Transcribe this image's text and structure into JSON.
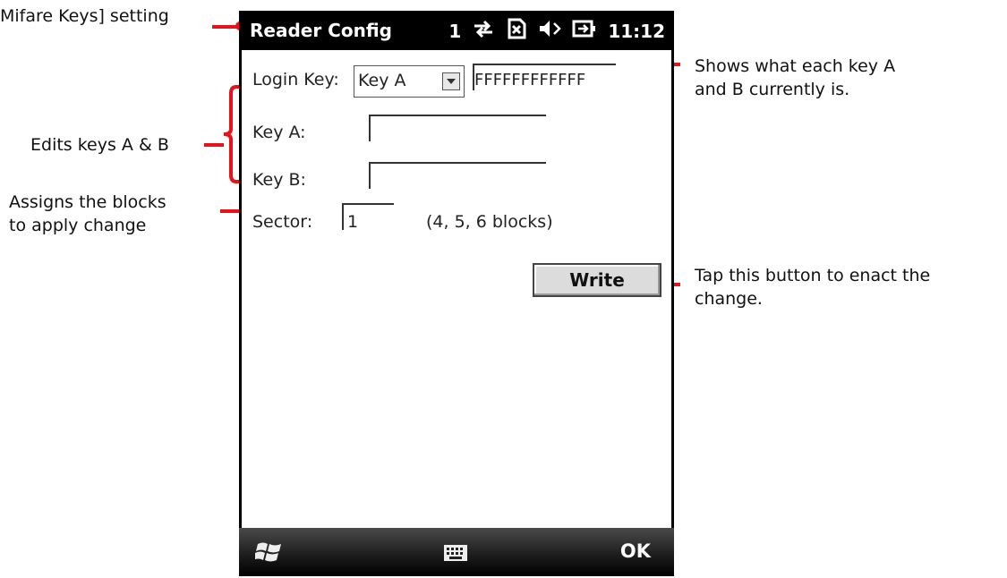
{
  "annotations": {
    "title_setting": "Mifare Keys] setting",
    "edits_keys": "Edits keys A & B",
    "assigns_line1": "Assigns the blocks",
    "assigns_line2": "to apply change",
    "shows_line1": "Shows what each key A",
    "shows_line2": "and B currently is.",
    "tap_line1": "Tap this button to enact the",
    "tap_line2": "change."
  },
  "titlebar": {
    "title": "Reader Config",
    "signal_number": "1",
    "time": "11:12"
  },
  "form": {
    "login_key_label": "Login Key:",
    "login_key_selected": "Key A",
    "login_key_value": "FFFFFFFFFFFF",
    "key_a_label": "Key A:",
    "key_a_value": "",
    "key_b_label": "Key B:",
    "key_b_value": "",
    "sector_label": "Sector:",
    "sector_value": "1",
    "sector_hint": "(4, 5, 6 blocks)",
    "write_label": "Write"
  },
  "menubar": {
    "ok_label": "OK"
  },
  "colors": {
    "annotation_red": "#e8121b",
    "bar_black": "#000000"
  },
  "icons": [
    "sync-icon",
    "no-sim-icon",
    "speaker-mute-icon",
    "battery-charging-icon",
    "windows-start-icon",
    "keyboard-icon"
  ]
}
